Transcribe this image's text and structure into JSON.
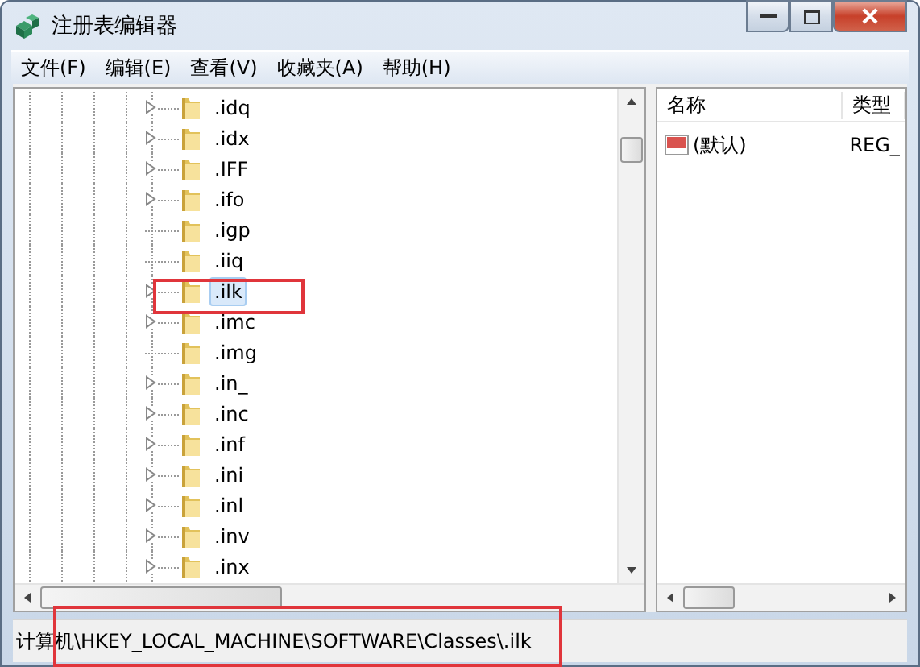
{
  "window": {
    "title": "注册表编辑器"
  },
  "menu": [
    "文件(F)",
    "编辑(E)",
    "查看(V)",
    "收藏夹(A)",
    "帮助(H)"
  ],
  "tree": [
    {
      "label": ".idq",
      "expandable": true,
      "selected": false
    },
    {
      "label": ".idx",
      "expandable": true,
      "selected": false
    },
    {
      "label": ".IFF",
      "expandable": true,
      "selected": false
    },
    {
      "label": ".ifo",
      "expandable": true,
      "selected": false
    },
    {
      "label": ".igp",
      "expandable": false,
      "selected": false
    },
    {
      "label": ".iiq",
      "expandable": false,
      "selected": false
    },
    {
      "label": ".ilk",
      "expandable": true,
      "selected": true
    },
    {
      "label": ".imc",
      "expandable": true,
      "selected": false
    },
    {
      "label": ".img",
      "expandable": false,
      "selected": false
    },
    {
      "label": ".in_",
      "expandable": true,
      "selected": false
    },
    {
      "label": ".inc",
      "expandable": true,
      "selected": false
    },
    {
      "label": ".inf",
      "expandable": true,
      "selected": false
    },
    {
      "label": ".ini",
      "expandable": true,
      "selected": false
    },
    {
      "label": ".inl",
      "expandable": true,
      "selected": false
    },
    {
      "label": ".inv",
      "expandable": true,
      "selected": false
    },
    {
      "label": ".inx",
      "expandable": true,
      "selected": false
    }
  ],
  "values": {
    "columns": [
      "名称",
      "类型"
    ],
    "rows": [
      {
        "name": "(默认)",
        "type": "REG_"
      }
    ]
  },
  "status_bar": "计算机\\HKEY_LOCAL_MACHINE\\SOFTWARE\\Classes\\.ilk"
}
